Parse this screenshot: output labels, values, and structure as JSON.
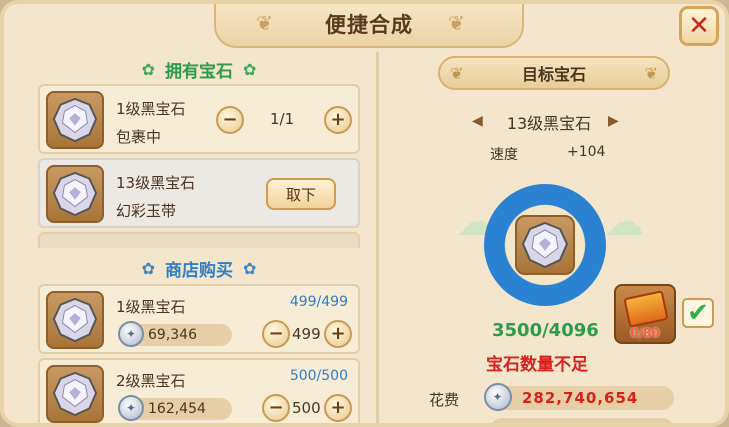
{
  "window": {
    "title": "便捷合成",
    "close_label": "✕"
  },
  "owned": {
    "header": "拥有宝石",
    "items": [
      {
        "name": "1级黑宝石",
        "location": "包裹中",
        "qty": "1/1",
        "minus": "−",
        "plus": "+"
      },
      {
        "name": "13级黑宝石",
        "location": "幻彩玉带",
        "action": "取下"
      }
    ]
  },
  "shop": {
    "header": "商店购买",
    "items": [
      {
        "name": "1级黑宝石",
        "stock": "499/499",
        "price": "69,346",
        "qty": "499",
        "minus": "−",
        "plus": "+"
      },
      {
        "name": "2级黑宝石",
        "stock": "500/500",
        "price": "162,454",
        "qty": "500",
        "minus": "−",
        "plus": "+"
      }
    ]
  },
  "target": {
    "header": "目标宝石",
    "name": "13级黑宝石",
    "stat_label": "速度",
    "stat_value": "+104",
    "progress": "3500/4096",
    "warning": "宝石数量不足",
    "charm_count": "0/80",
    "checkbox_mark": "✔",
    "cost_label": "花费",
    "cost_value": "282,740,654"
  },
  "colors": {
    "green": "#2d9b4a",
    "blue": "#2f7fc6",
    "red": "#d8211c"
  },
  "icons": [
    "close-icon",
    "gem-icon",
    "silver-coin-icon",
    "charm-box-icon",
    "checkmark-icon"
  ]
}
